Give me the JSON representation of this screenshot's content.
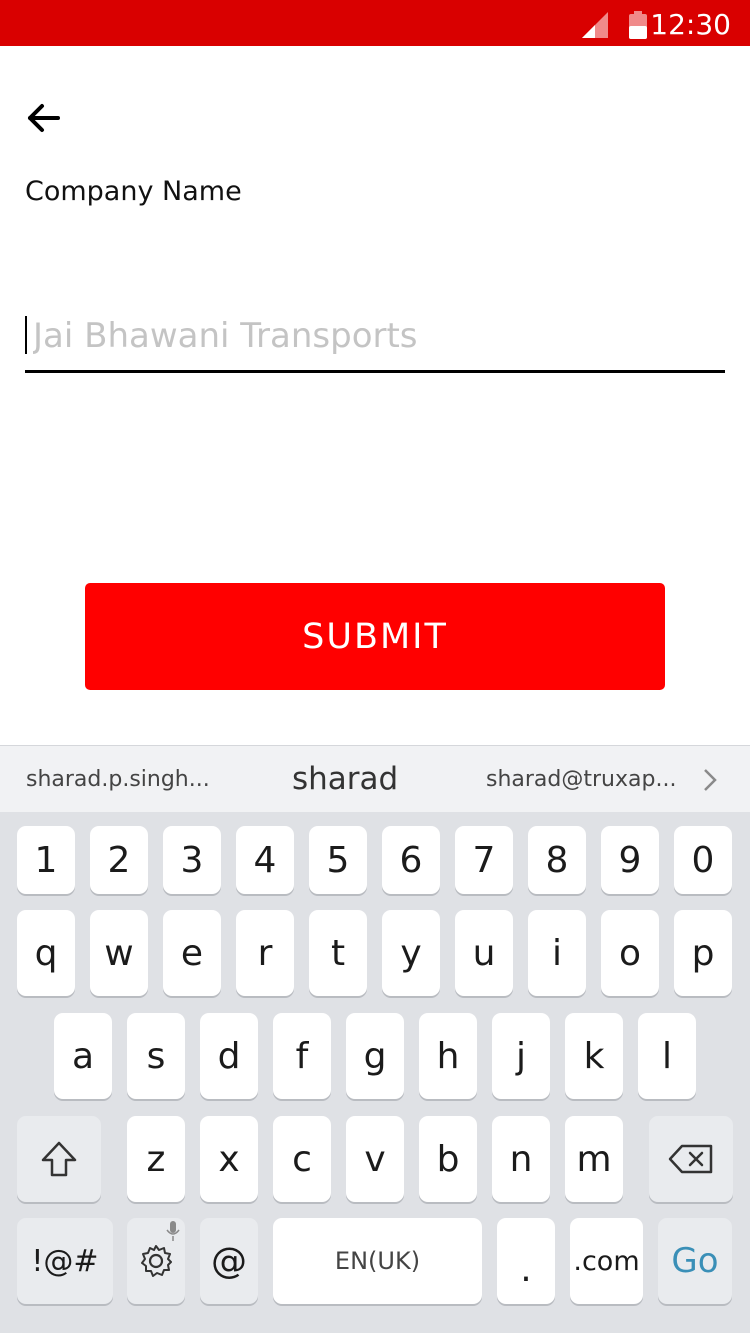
{
  "status_bar": {
    "time": "12:30"
  },
  "page": {
    "title": "Company Name",
    "input_placeholder": "Jai Bhawani Transports",
    "submit_label": "SUBMIT"
  },
  "keyboard": {
    "suggestions": [
      "sharad.p.singh...",
      "sharad",
      "sharad@truxap..."
    ],
    "row_numbers": [
      "1",
      "2",
      "3",
      "4",
      "5",
      "6",
      "7",
      "8",
      "9",
      "0"
    ],
    "row_1": [
      "q",
      "w",
      "e",
      "r",
      "t",
      "y",
      "u",
      "i",
      "o",
      "p"
    ],
    "row_2": [
      "a",
      "s",
      "d",
      "f",
      "g",
      "h",
      "j",
      "k",
      "l"
    ],
    "row_3": [
      "z",
      "x",
      "c",
      "v",
      "b",
      "n",
      "m"
    ],
    "symbols_label": "!@#",
    "at_label": "@",
    "space_label": "EN(UK)",
    "period_label": ".",
    "dotcom_label": ".com",
    "go_label": "Go",
    "go_color": "#3a8fb7"
  },
  "colors": {
    "status_bar": "#d90000",
    "submit": "#ff0000"
  }
}
